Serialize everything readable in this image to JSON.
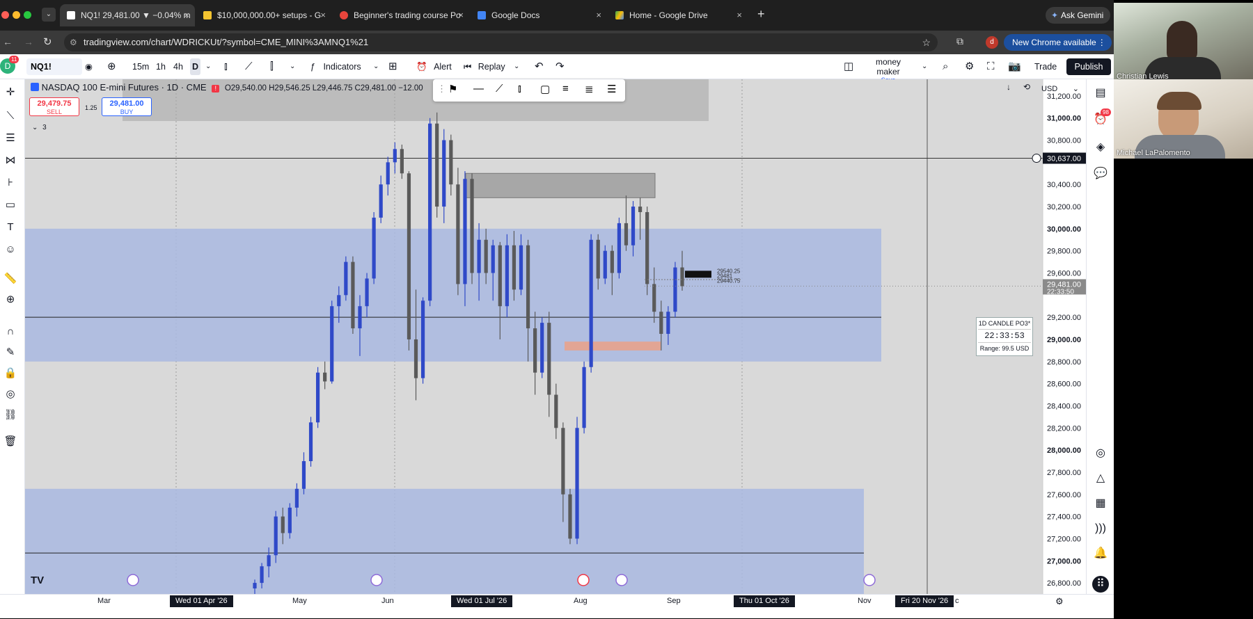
{
  "browser": {
    "tabs": [
      {
        "label": "NQ1! 29,481.00 ▼ −0.04% m",
        "active": true
      },
      {
        "label": "$10,000,000.00+ setups - G"
      },
      {
        "label": "Beginner's trading course Po"
      },
      {
        "label": "Google Docs"
      },
      {
        "label": "Home - Google Drive"
      }
    ],
    "notification_badge": "11",
    "ask_gemini": "Ask Gemini",
    "url": "tradingview.com/chart/WDRICKUt/?symbol=CME_MINI%3AMNQ1%21",
    "new_chrome": "New Chrome available",
    "profile_initial": "d"
  },
  "toolbar": {
    "symbol": "NQ1!",
    "intervals": [
      "15m",
      "1h",
      "4h",
      "D"
    ],
    "indicators": "Indicators",
    "alert": "Alert",
    "replay": "Replay",
    "layout_name": "money maker",
    "layout_save": "Save",
    "trade": "Trade",
    "publish": "Publish"
  },
  "legend": {
    "title": "NASDAQ 100 E-mini Futures · 1D · CME",
    "ohlc": "O29,540.00 H29,546.25 L29,446.75 C29,481.00 −12.00",
    "sell_price": "29,479.75",
    "sell_label": "SELL",
    "spread": "1.25",
    "buy_price": "29,481.00",
    "buy_label": "BUY",
    "collapsed_count": "3"
  },
  "currency": "USD",
  "price_axis": {
    "ticks": [
      "31,200.00",
      "31,000.00",
      "30,800.00",
      "30,637.00",
      "30,400.00",
      "30,200.00",
      "30,000.00",
      "29,800.00",
      "29,600.00",
      "29,200.00",
      "29,000.00",
      "28,800.00",
      "28,600.00",
      "28,400.00",
      "28,200.00",
      "28,000.00",
      "27,800.00",
      "27,600.00",
      "27,400.00",
      "27,200.00",
      "27,000.00",
      "26,800.00"
    ],
    "last_price": "29,481.00",
    "countdown": "22:33:50",
    "crosshair_price": "30,637.00"
  },
  "timer_widget": {
    "title": "1D CANDLE PO3*",
    "time": "22:33:53",
    "range": "Range: 99.5 USD"
  },
  "position_labels": [
    "29540.25",
    "29481",
    "29440.75"
  ],
  "time_axis": {
    "labels": [
      "Mar",
      "May",
      "Jun",
      "Aug",
      "Sep",
      "Nov"
    ],
    "badges": [
      "Wed 01 Apr '26",
      "Wed 01 Jul '26",
      "Thu 01 Oct '26",
      "Fri 20 Nov '26"
    ],
    "trailing": "c"
  },
  "alerts_badge": "98",
  "participants": [
    "Christian Lewis",
    "Michael LaPalomento"
  ],
  "colors": {
    "bull": "#2f49c8",
    "bear": "#5a5a5a",
    "zone": "#a9b8e0",
    "chart_bg": "#d9d9d9"
  },
  "chart_data": {
    "type": "candlestick",
    "title": "NASDAQ 100 E-mini Futures · 1D · CME",
    "ylim": [
      26700,
      31350
    ],
    "x_labels": [
      "Mar",
      "May",
      "Jun",
      "Aug",
      "Sep",
      "Nov"
    ],
    "zones": [
      {
        "from": 28800,
        "to": 30000
      },
      {
        "from": 26700,
        "to": 27650
      }
    ],
    "supply_box": {
      "from": 30280,
      "to": 30500
    },
    "demand_box": {
      "from": 28900,
      "to": 28980
    },
    "horizontal_lines": [
      30637,
      29200,
      27070
    ],
    "candles": [
      {
        "o": 26750,
        "h": 26830,
        "l": 26700,
        "c": 26800
      },
      {
        "o": 26800,
        "h": 26980,
        "l": 26750,
        "c": 26950
      },
      {
        "o": 26950,
        "h": 27120,
        "l": 26850,
        "c": 27050
      },
      {
        "o": 27050,
        "h": 27450,
        "l": 26980,
        "c": 27400
      },
      {
        "o": 27400,
        "h": 27480,
        "l": 27150,
        "c": 27250
      },
      {
        "o": 27250,
        "h": 27520,
        "l": 27200,
        "c": 27480
      },
      {
        "o": 27480,
        "h": 27700,
        "l": 27400,
        "c": 27650
      },
      {
        "o": 27650,
        "h": 27980,
        "l": 27600,
        "c": 27900
      },
      {
        "o": 27900,
        "h": 28300,
        "l": 27850,
        "c": 28250
      },
      {
        "o": 28250,
        "h": 28750,
        "l": 28200,
        "c": 28700
      },
      {
        "o": 28700,
        "h": 28800,
        "l": 28550,
        "c": 28620
      },
      {
        "o": 28620,
        "h": 29350,
        "l": 28600,
        "c": 29300
      },
      {
        "o": 29300,
        "h": 29480,
        "l": 29150,
        "c": 29400
      },
      {
        "o": 29400,
        "h": 29750,
        "l": 29350,
        "c": 29700
      },
      {
        "o": 29700,
        "h": 29750,
        "l": 29050,
        "c": 29100
      },
      {
        "o": 29100,
        "h": 29400,
        "l": 28850,
        "c": 29300
      },
      {
        "o": 29300,
        "h": 29600,
        "l": 29200,
        "c": 29550
      },
      {
        "o": 29550,
        "h": 30150,
        "l": 29500,
        "c": 30100
      },
      {
        "o": 30100,
        "h": 30480,
        "l": 30050,
        "c": 30400
      },
      {
        "o": 30400,
        "h": 30650,
        "l": 30300,
        "c": 30600
      },
      {
        "o": 30600,
        "h": 30780,
        "l": 30500,
        "c": 30720
      },
      {
        "o": 30720,
        "h": 30760,
        "l": 30450,
        "c": 30500
      },
      {
        "o": 30500,
        "h": 30520,
        "l": 28900,
        "c": 29000
      },
      {
        "o": 29000,
        "h": 29450,
        "l": 28450,
        "c": 28650
      },
      {
        "o": 28650,
        "h": 29380,
        "l": 28600,
        "c": 29350
      },
      {
        "o": 29350,
        "h": 31000,
        "l": 29300,
        "c": 30950
      },
      {
        "o": 30950,
        "h": 31050,
        "l": 30100,
        "c": 30200
      },
      {
        "o": 30200,
        "h": 30900,
        "l": 30050,
        "c": 30800
      },
      {
        "o": 30800,
        "h": 30850,
        "l": 30300,
        "c": 30400
      },
      {
        "o": 30400,
        "h": 30550,
        "l": 29400,
        "c": 29500
      },
      {
        "o": 29500,
        "h": 30520,
        "l": 29300,
        "c": 30450
      },
      {
        "o": 30450,
        "h": 30500,
        "l": 29500,
        "c": 29600
      },
      {
        "o": 29600,
        "h": 30050,
        "l": 29350,
        "c": 29900
      },
      {
        "o": 29900,
        "h": 30000,
        "l": 29500,
        "c": 29600
      },
      {
        "o": 29600,
        "h": 29900,
        "l": 29350,
        "c": 29850
      },
      {
        "o": 29850,
        "h": 29880,
        "l": 29000,
        "c": 29300
      },
      {
        "o": 29300,
        "h": 29950,
        "l": 29200,
        "c": 29850
      },
      {
        "o": 29850,
        "h": 29980,
        "l": 29350,
        "c": 29450
      },
      {
        "o": 29450,
        "h": 29950,
        "l": 29400,
        "c": 29850
      },
      {
        "o": 29850,
        "h": 29900,
        "l": 28800,
        "c": 29100
      },
      {
        "o": 29100,
        "h": 29250,
        "l": 28500,
        "c": 28700
      },
      {
        "o": 28700,
        "h": 29200,
        "l": 28650,
        "c": 29150
      },
      {
        "o": 29150,
        "h": 29250,
        "l": 28300,
        "c": 28500
      },
      {
        "o": 28500,
        "h": 28600,
        "l": 28100,
        "c": 28200
      },
      {
        "o": 28200,
        "h": 28250,
        "l": 27350,
        "c": 27600
      },
      {
        "o": 27600,
        "h": 27650,
        "l": 27150,
        "c": 27200
      },
      {
        "o": 27200,
        "h": 28300,
        "l": 27150,
        "c": 28200
      },
      {
        "o": 28200,
        "h": 28800,
        "l": 28150,
        "c": 28750
      },
      {
        "o": 28750,
        "h": 29950,
        "l": 28700,
        "c": 29900
      },
      {
        "o": 29900,
        "h": 29950,
        "l": 29450,
        "c": 29550
      },
      {
        "o": 29550,
        "h": 29850,
        "l": 29500,
        "c": 29800
      },
      {
        "o": 29800,
        "h": 29850,
        "l": 29400,
        "c": 29600
      },
      {
        "o": 29600,
        "h": 30100,
        "l": 29550,
        "c": 30050
      },
      {
        "o": 30050,
        "h": 30300,
        "l": 29800,
        "c": 29850
      },
      {
        "o": 29850,
        "h": 30250,
        "l": 29750,
        "c": 30200
      },
      {
        "o": 30200,
        "h": 30280,
        "l": 29900,
        "c": 30150
      },
      {
        "o": 30150,
        "h": 30200,
        "l": 29400,
        "c": 29500
      },
      {
        "o": 29500,
        "h": 29650,
        "l": 29150,
        "c": 29250
      },
      {
        "o": 29250,
        "h": 29350,
        "l": 28900,
        "c": 29050
      },
      {
        "o": 29050,
        "h": 29300,
        "l": 28950,
        "c": 29250
      },
      {
        "o": 29250,
        "h": 29700,
        "l": 29200,
        "c": 29650
      },
      {
        "o": 29650,
        "h": 29800,
        "l": 29440,
        "c": 29481
      }
    ]
  }
}
